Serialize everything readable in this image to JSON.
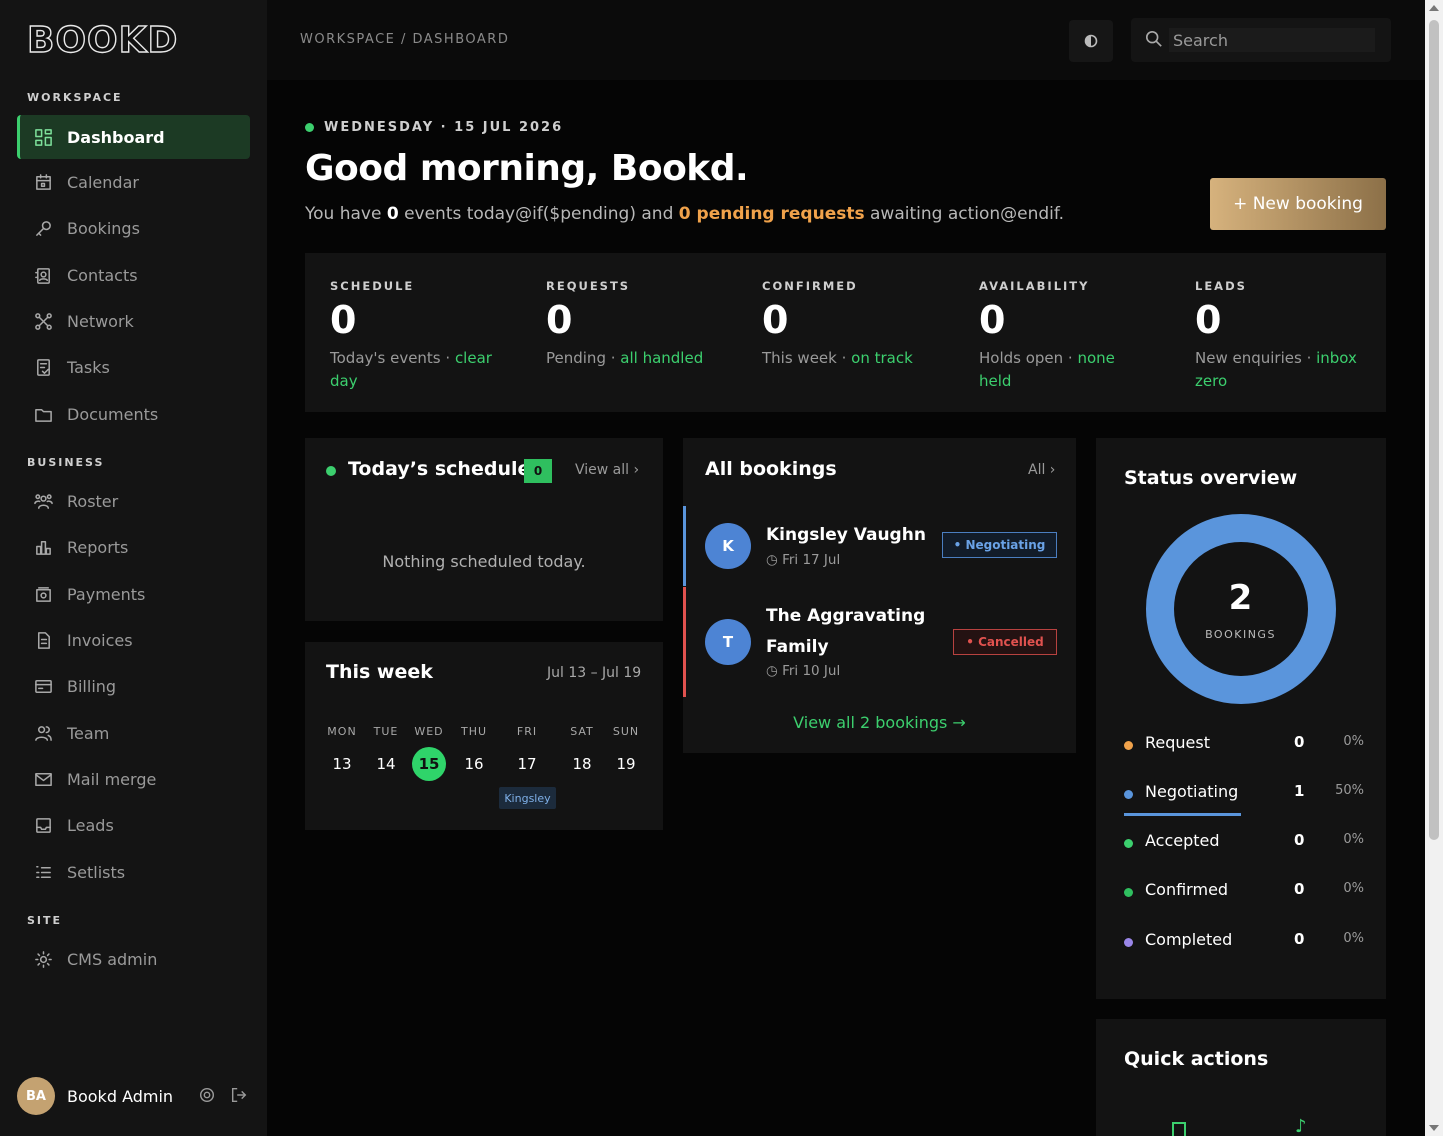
{
  "app": {
    "logo": "BOOKD"
  },
  "sidebar": {
    "sections": [
      {
        "title": "WORKSPACE",
        "items": [
          {
            "label": "Dashboard",
            "icon": "dashboard-icon",
            "active": true
          },
          {
            "label": "Calendar",
            "icon": "calendar-icon"
          },
          {
            "label": "Bookings",
            "icon": "key-icon"
          },
          {
            "label": "Contacts",
            "icon": "contacts-icon"
          },
          {
            "label": "Network",
            "icon": "network-icon"
          },
          {
            "label": "Tasks",
            "icon": "tasks-icon"
          },
          {
            "label": "Documents",
            "icon": "folder-icon"
          }
        ]
      },
      {
        "title": "BUSINESS",
        "items": [
          {
            "label": "Roster",
            "icon": "roster-icon"
          },
          {
            "label": "Reports",
            "icon": "reports-icon"
          },
          {
            "label": "Payments",
            "icon": "payments-icon"
          },
          {
            "label": "Invoices",
            "icon": "invoice-icon"
          },
          {
            "label": "Billing",
            "icon": "billing-icon"
          },
          {
            "label": "Team",
            "icon": "team-icon"
          },
          {
            "label": "Mail merge",
            "icon": "mail-icon"
          },
          {
            "label": "Leads",
            "icon": "inbox-icon"
          },
          {
            "label": "Setlists",
            "icon": "list-icon"
          }
        ]
      },
      {
        "title": "SITE",
        "items": [
          {
            "label": "CMS admin",
            "icon": "gear-icon"
          }
        ]
      }
    ],
    "user": {
      "initials": "BA",
      "name": "Bookd Admin"
    }
  },
  "topbar": {
    "breadcrumb": "WORKSPACE / DASHBOARD",
    "search_placeholder": "Search"
  },
  "header": {
    "date": "WEDNESDAY · 15 JUL 2026",
    "greeting": "Good morning, Bookd.",
    "sub_prefix": "You have ",
    "sub_events": "0",
    "sub_mid": " events today@if($pending) and ",
    "sub_pending": "0 pending requests",
    "sub_suffix": " awaiting action@endif.",
    "new_booking": "+ New booking"
  },
  "stats": [
    {
      "label": "SCHEDULE",
      "value": "0",
      "desc": "Today's events · ",
      "accent": "clear day"
    },
    {
      "label": "REQUESTS",
      "value": "0",
      "desc": "Pending · ",
      "accent": "all handled"
    },
    {
      "label": "CONFIRMED",
      "value": "0",
      "desc": "This week · ",
      "accent": "on track"
    },
    {
      "label": "AVAILABILITY",
      "value": "0",
      "desc": "Holds open · ",
      "accent": "none held"
    },
    {
      "label": "LEADS",
      "value": "0",
      "desc": "New enquiries · ",
      "accent": "inbox zero"
    }
  ],
  "schedule": {
    "title": "Today’s schedule",
    "count": "0",
    "view_all": "View all ›",
    "empty": "Nothing scheduled today."
  },
  "week": {
    "title": "This week",
    "range": "Jul 13 – Jul 19",
    "days": [
      {
        "name": "MON",
        "num": "13"
      },
      {
        "name": "TUE",
        "num": "14"
      },
      {
        "name": "WED",
        "num": "15",
        "today": true
      },
      {
        "name": "THU",
        "num": "16"
      },
      {
        "name": "FRI",
        "num": "17"
      },
      {
        "name": "SAT",
        "num": "18"
      },
      {
        "name": "SUN",
        "num": "19"
      }
    ],
    "event": "Kingsley"
  },
  "bookings": {
    "title": "All bookings",
    "filter": "All ›",
    "items": [
      {
        "initial": "K",
        "name": "Kingsley Vaughn",
        "date": "◷ Fri 17 Jul",
        "status": "• Negotiating",
        "color": "#5a95dc"
      },
      {
        "initial": "T",
        "name": "The Aggravating Family",
        "date": "◷ Fri 10 Jul",
        "status": "• Cancelled",
        "color": "#e0524f"
      }
    ],
    "view_all": "View all 2 bookings →"
  },
  "status": {
    "title": "Status overview",
    "total": "2",
    "total_label": "BOOKINGS",
    "rows": [
      {
        "name": "Request",
        "count": "0",
        "pct": "0%",
        "color": "#f0a24b"
      },
      {
        "name": "Negotiating",
        "count": "1",
        "pct": "50%",
        "color": "#5a95dc"
      },
      {
        "name": "Accepted",
        "count": "0",
        "pct": "0%",
        "color": "#3ccf6e"
      },
      {
        "name": "Confirmed",
        "count": "0",
        "pct": "0%",
        "color": "#2fbf5f"
      },
      {
        "name": "Completed",
        "count": "0",
        "pct": "0%",
        "color": "#9a86e8"
      }
    ]
  },
  "quick_actions": {
    "title": "Quick actions"
  }
}
